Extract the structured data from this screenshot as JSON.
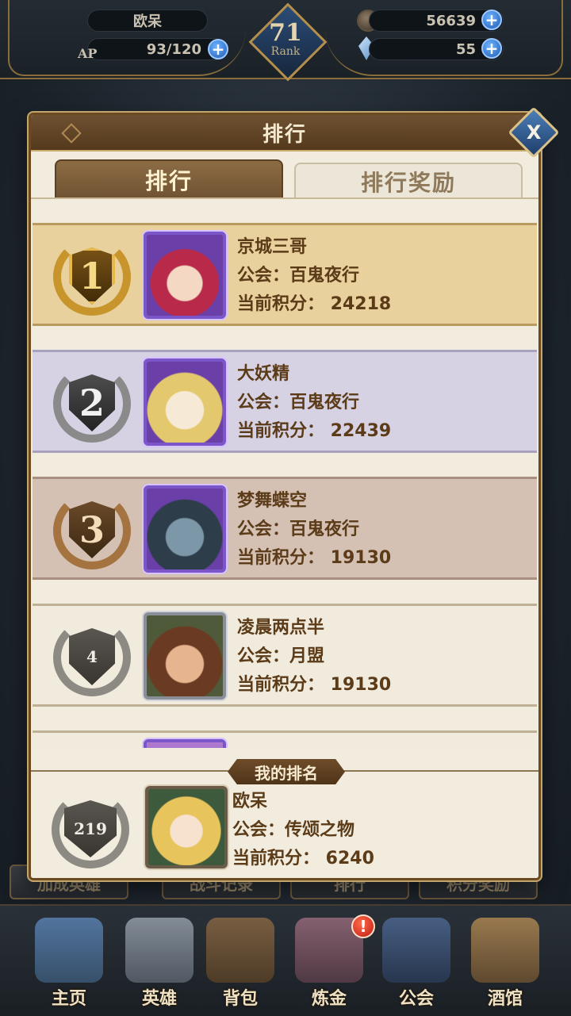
{
  "topbar": {
    "player_name": "欧呆",
    "ap_label": "AP",
    "ap_value": "93/120",
    "rank_number": "71",
    "rank_label": "Rank",
    "gold": "56639",
    "gems": "55",
    "plus": "+"
  },
  "modal": {
    "title": "排行",
    "close": "X",
    "tabs": [
      {
        "label": "排行",
        "active": true
      },
      {
        "label": "排行奖励",
        "active": false
      }
    ],
    "entries": [
      {
        "rank": "1",
        "name": "京城三哥",
        "guild": "公会：百鬼夜行",
        "score": "当前积分： 24218"
      },
      {
        "rank": "2",
        "name": "大妖精",
        "guild": "公会：百鬼夜行",
        "score": "当前积分： 22439"
      },
      {
        "rank": "3",
        "name": "梦舞蝶空",
        "guild": "公会：百鬼夜行",
        "score": "当前积分： 19130"
      },
      {
        "rank": "4",
        "name": "凌晨两点半",
        "guild": "公会：月盟",
        "score": "当前积分： 19130"
      }
    ],
    "my_rank": {
      "label": "我的排名",
      "rank": "219",
      "name": "欧呆",
      "guild": "公会：传颂之物",
      "score": "当前积分： 6240"
    }
  },
  "under_buttons": [
    "加成英雄",
    "战斗记录",
    "排行",
    "积分奖励"
  ],
  "bottom_nav": [
    {
      "label": "主页"
    },
    {
      "label": "英雄"
    },
    {
      "label": "背包"
    },
    {
      "label": "炼金"
    },
    {
      "label": "公会"
    },
    {
      "label": "酒馆"
    }
  ],
  "alert_mark": "!"
}
